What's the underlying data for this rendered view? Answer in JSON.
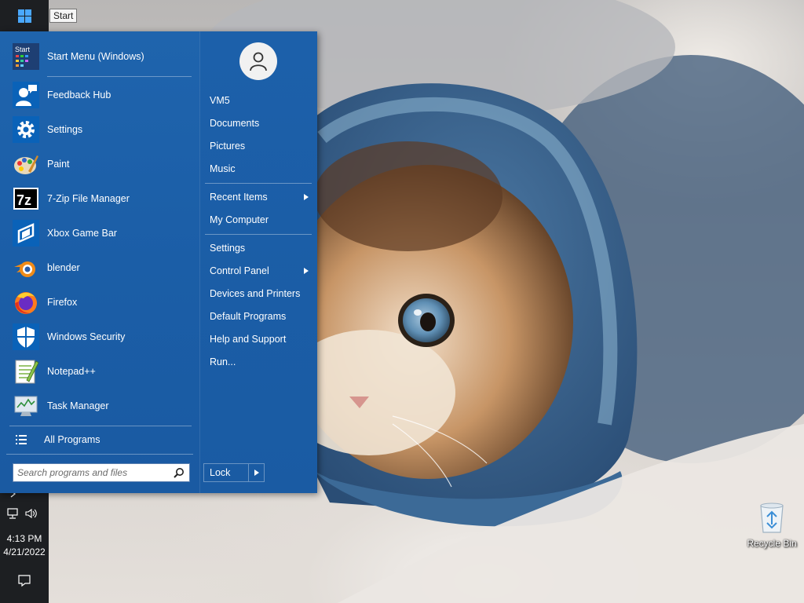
{
  "taskbar": {
    "tooltip": "Start",
    "clock_time": "4:13 PM",
    "clock_date": "4/21/2022"
  },
  "start_menu": {
    "pinned_apps": [
      {
        "label": "Start Menu (Windows)",
        "icon": "start-menu-icon"
      },
      {
        "label": "Feedback Hub",
        "icon": "feedback-hub-icon"
      },
      {
        "label": "Settings",
        "icon": "settings-gear-icon"
      },
      {
        "label": "Paint",
        "icon": "paint-palette-icon"
      },
      {
        "label": "7-Zip File Manager",
        "icon": "7zip-icon"
      },
      {
        "label": "Xbox Game Bar",
        "icon": "xbox-game-bar-icon"
      },
      {
        "label": "blender",
        "icon": "blender-icon"
      },
      {
        "label": "Firefox",
        "icon": "firefox-icon"
      },
      {
        "label": "Windows Security",
        "icon": "shield-icon"
      },
      {
        "label": "Notepad++",
        "icon": "notepad-plus-plus-icon"
      },
      {
        "label": "Task Manager",
        "icon": "task-manager-icon"
      }
    ],
    "start_icon_text": "Start",
    "sevenzip_icon_text": "7z",
    "all_programs_label": "All Programs",
    "search_placeholder": "Search programs and files",
    "places": [
      {
        "label": "VM5",
        "submenu": false
      },
      {
        "label": "Documents",
        "submenu": false
      },
      {
        "label": "Pictures",
        "submenu": false
      },
      {
        "label": "Music",
        "submenu": false
      },
      {
        "label": "Recent Items",
        "submenu": true
      },
      {
        "label": "My Computer",
        "submenu": false
      },
      {
        "label": "Settings",
        "submenu": false
      },
      {
        "label": "Control Panel",
        "submenu": true
      },
      {
        "label": "Devices and Printers",
        "submenu": false
      },
      {
        "label": "Default Programs",
        "submenu": false
      },
      {
        "label": "Help and Support",
        "submenu": false
      },
      {
        "label": "Run...",
        "submenu": false
      }
    ],
    "lock_label": "Lock"
  },
  "desktop": {
    "recycle_bin_label": "Recycle Bin"
  },
  "colors": {
    "menu_blue": "#1b5ea7",
    "taskbar": "#1d1f22",
    "accent": "#0078d7"
  }
}
